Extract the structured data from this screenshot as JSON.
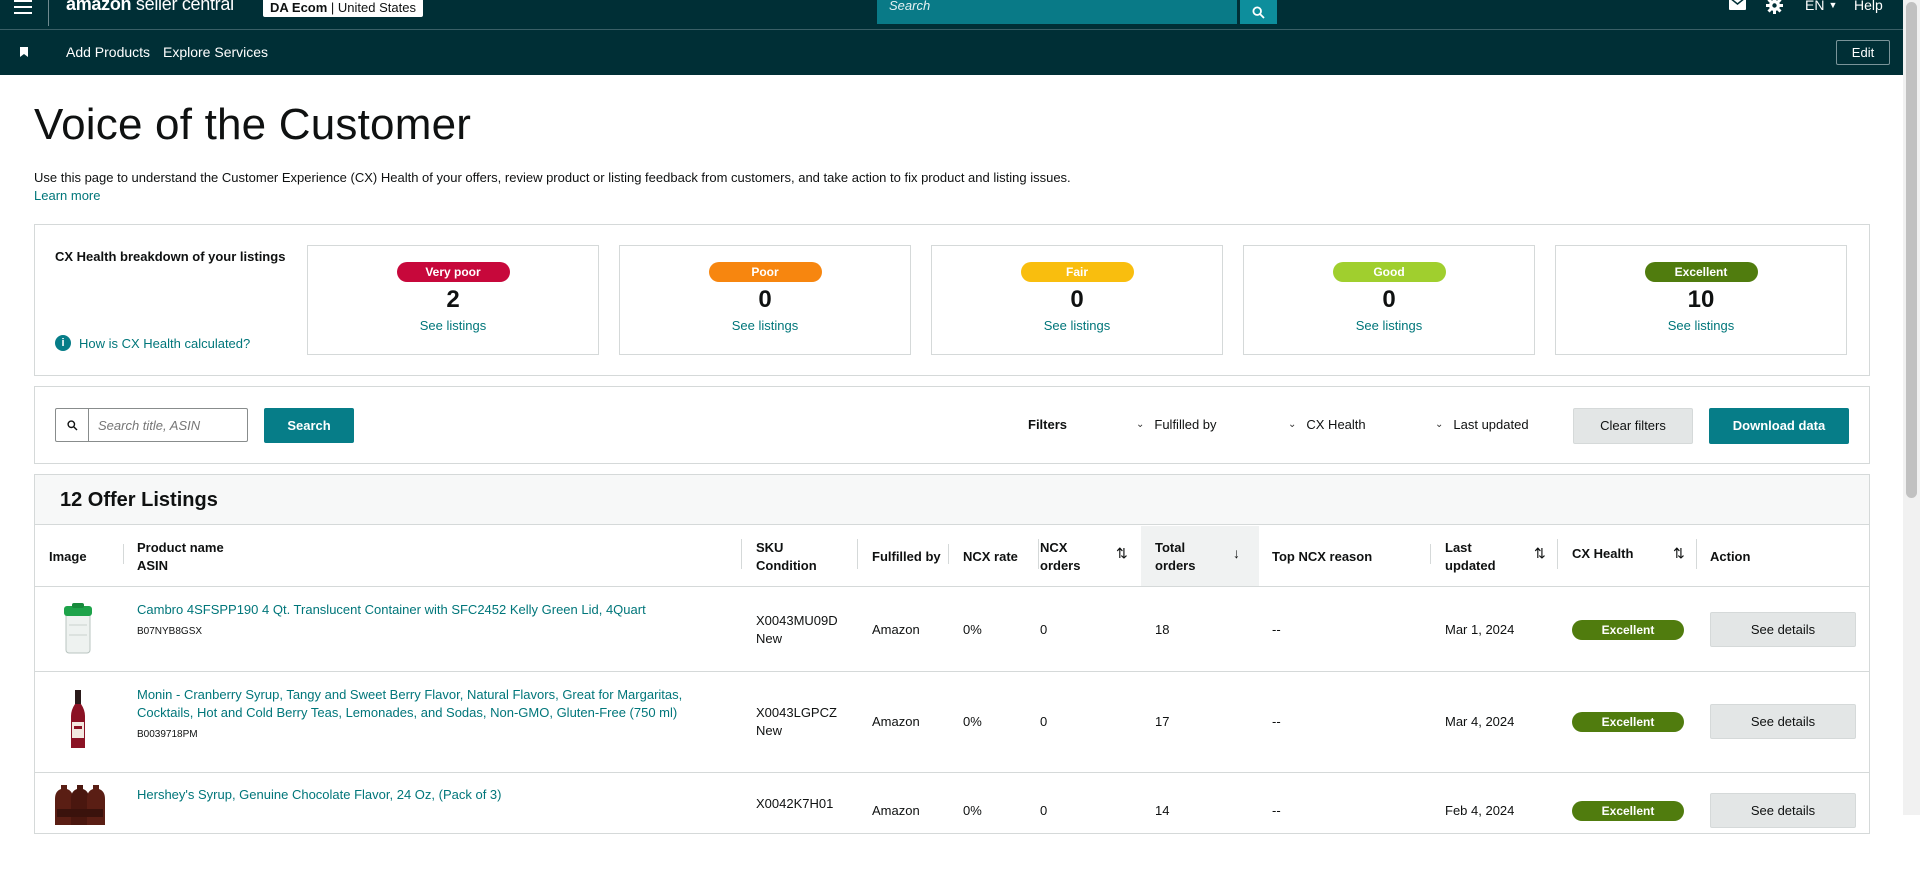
{
  "topbar": {
    "logo_brand": "amazon",
    "logo_suffix": "seller central",
    "store_name": "DA Ecom",
    "store_country": "United States",
    "search_placeholder": "Search",
    "language": "EN",
    "help": "Help"
  },
  "subnav": {
    "items": [
      "Add Products",
      "Explore Services"
    ],
    "edit": "Edit"
  },
  "page": {
    "title": "Voice of the Customer",
    "intro": "Use this page to understand the Customer Experience (CX) Health of your offers, review product or listing feedback from customers, and take action to fix product and listing issues.",
    "learn_more": "Learn more"
  },
  "cx_health": {
    "label": "CX Health breakdown of your listings",
    "how_link": "How is CX Health calculated?",
    "cards": [
      {
        "status": "Very poor",
        "count": "2",
        "link": "See listings",
        "color": "#c7083b"
      },
      {
        "status": "Poor",
        "count": "0",
        "link": "See listings",
        "color": "#f7860f"
      },
      {
        "status": "Fair",
        "count": "0",
        "link": "See listings",
        "color": "#f9be0e"
      },
      {
        "status": "Good",
        "count": "0",
        "link": "See listings",
        "color": "#a0cf2e"
      },
      {
        "status": "Excellent",
        "count": "10",
        "link": "See listings",
        "color": "#507c0e"
      }
    ]
  },
  "filters": {
    "search_placeholder": "Search title, ASIN",
    "search_button": "Search",
    "label": "Filters",
    "dropdowns": [
      "Fulfilled by",
      "CX Health",
      "Last updated"
    ],
    "clear": "Clear filters",
    "download": "Download data"
  },
  "table": {
    "title": "12 Offer Listings",
    "headers": {
      "image": "Image",
      "product_name": "Product name",
      "asin": "ASIN",
      "sku": "SKU",
      "condition": "Condition",
      "fulfilled_by": "Fulfilled by",
      "ncx_rate": "NCX rate",
      "ncx_orders_1": "NCX",
      "ncx_orders_2": "orders",
      "total_orders_1": "Total",
      "total_orders_2": "orders",
      "top_reason": "Top NCX reason",
      "last_updated_1": "Last",
      "last_updated_2": "updated",
      "cx_health": "CX Health",
      "action": "Action"
    },
    "rows": [
      {
        "name": "Cambro 4SFSPP190 4 Qt. Translucent Container with SFC2452 Kelly Green Lid, 4Quart",
        "asin": "B07NYB8GSX",
        "sku": "X0043MU09D",
        "condition": "New",
        "fulfilled_by": "Amazon",
        "ncx_rate": "0%",
        "ncx_orders": "0",
        "total_orders": "18",
        "top_reason": "--",
        "last_updated": "Mar 1, 2024",
        "cx_health": "Excellent",
        "action": "See details"
      },
      {
        "name": "Monin - Cranberry Syrup, Tangy and Sweet Berry Flavor, Natural Flavors, Great for Margaritas, Cocktails, Hot and Cold Berry Teas, Lemonades, and Sodas, Non-GMO, Gluten-Free (750 ml)",
        "asin": "B0039718PM",
        "sku": "X0043LGPCZ",
        "condition": "New",
        "fulfilled_by": "Amazon",
        "ncx_rate": "0%",
        "ncx_orders": "0",
        "total_orders": "17",
        "top_reason": "--",
        "last_updated": "Mar 4, 2024",
        "cx_health": "Excellent",
        "action": "See details"
      },
      {
        "name": "Hershey's Syrup, Genuine Chocolate Flavor, 24 Oz, (Pack of 3)",
        "sku": "X0042K7H01",
        "fulfilled_by": "Amazon",
        "ncx_rate": "0%",
        "ncx_orders": "0",
        "total_orders": "14",
        "top_reason": "--",
        "last_updated": "Feb 4, 2024",
        "cx_health": "Excellent",
        "action": "See details"
      }
    ]
  }
}
